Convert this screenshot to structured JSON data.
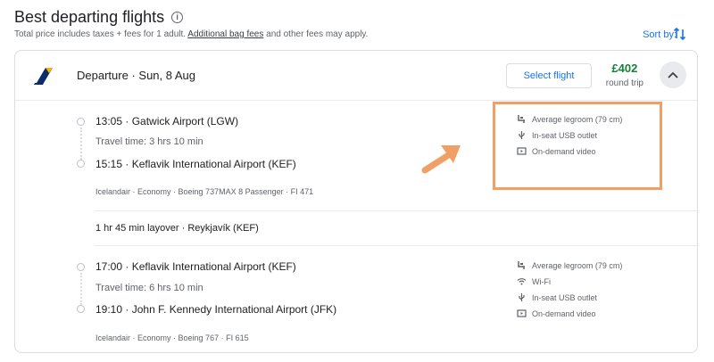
{
  "header": {
    "title": "Best departing flights",
    "subtitle_prefix": "Total price includes taxes + fees for 1 adult. ",
    "subtitle_link": "Additional bag fees",
    "subtitle_suffix": " and other fees may apply.",
    "sort_label": "Sort by:"
  },
  "card": {
    "departure_label": "Departure",
    "separator": "·",
    "date": "Sun, 8 Aug",
    "select_label": "Select flight",
    "price": "£402",
    "price_note": "round trip"
  },
  "segments": [
    {
      "dep_time": "13:05",
      "dep_airport": "Gatwick Airport (LGW)",
      "travel_time": "Travel time: 3 hrs 10 min",
      "arr_time": "15:15",
      "arr_airport": "Keflavik International Airport (KEF)",
      "details": "Icelandair · Economy · Boeing 737MAX 8 Passenger · FI 471",
      "amenities": [
        "Average legroom (79 cm)",
        "In-seat USB outlet",
        "On-demand video"
      ]
    },
    {
      "dep_time": "17:00",
      "dep_airport": "Keflavik International Airport (KEF)",
      "travel_time": "Travel time: 6 hrs 10 min",
      "arr_time": "19:10",
      "arr_airport": "John F. Kennedy International Airport (JFK)",
      "details": "Icelandair · Economy · Boeing 767 · FI 615",
      "amenities": [
        "Average legroom (79 cm)",
        "Wi-Fi",
        "In-seat USB outlet",
        "On-demand video"
      ]
    }
  ],
  "layover": "1 hr 45 min layover · Reykjavík (KEF)",
  "colors": {
    "accent": "#1a73e8",
    "price": "#188038",
    "annotation": "#f0a064"
  }
}
